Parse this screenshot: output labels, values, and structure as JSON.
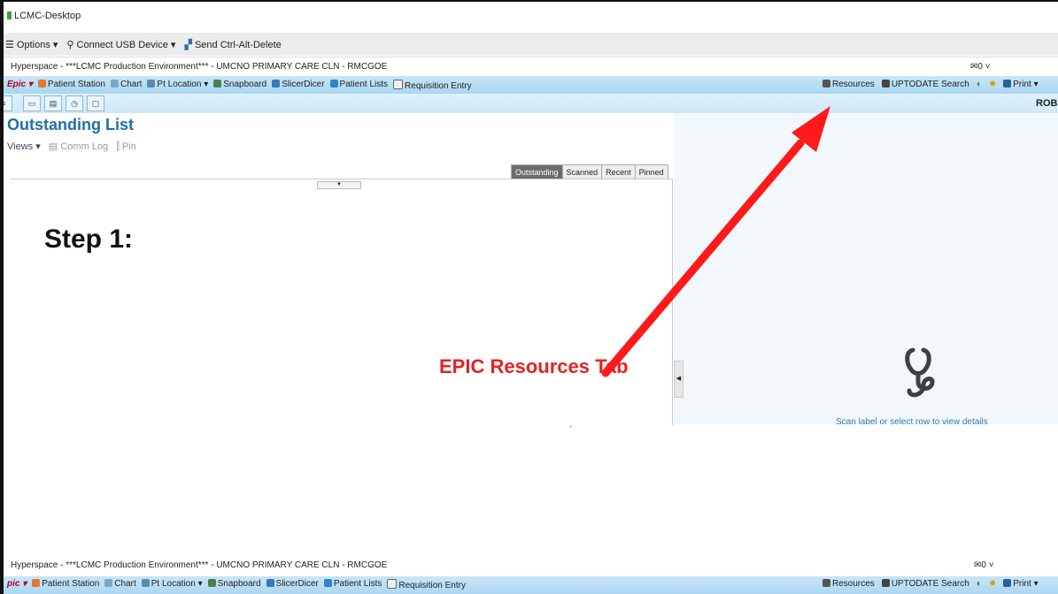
{
  "window": {
    "title": "LCMC-Desktop"
  },
  "rdp_toolbar": {
    "options": "Options ▾",
    "connect_usb": "Connect USB Device ▾",
    "send_cad": "Send Ctrl-Alt-Delete"
  },
  "hyperspace": {
    "title": "Hyperspace - ***LCMC Production Environment*** - UMCNO PRIMARY CARE CLN - RMCGOE",
    "mail_count": "✉0 ˅"
  },
  "epic_toolbar": {
    "logo": "Epic ▾",
    "items": [
      "Patient Station",
      "Chart",
      "Pt Location ▾",
      "Snapboard",
      "SlicerDicer",
      "Patient Lists",
      "Requisition Entry"
    ],
    "right_items": [
      "Resources",
      "UPTODATE Search",
      "Print ▾"
    ],
    "user": "ROB"
  },
  "activity": {
    "title": "Outstanding List",
    "views": "Views ▾",
    "comm_log": "Comm Log",
    "pin": "Pin",
    "tabs": [
      "Outstanding",
      "Scanned",
      "Recent",
      "Pinned"
    ],
    "active_tab": "Outstanding",
    "detail_hint": "Scan label or select row to view details"
  },
  "annotation": {
    "step": "Step 1:",
    "label": "EPIC Resources Tab",
    "color": "#e32222"
  },
  "hyperspace_bottom": {
    "title": "Hyperspace - ***LCMC Production Environment*** - UMCNO PRIMARY CARE CLN - RMCGOE",
    "mail_count": "✉0 ˅"
  },
  "epic_toolbar_bottom": {
    "logo": "pic ▾",
    "items": [
      "Patient Station",
      "Chart",
      "Pt Location ▾",
      "Snapboard",
      "SlicerDicer",
      "Patient Lists",
      "Requisition Entry"
    ],
    "right_items": [
      "Resources",
      "UPTODATE Search",
      "Print ▾"
    ]
  }
}
